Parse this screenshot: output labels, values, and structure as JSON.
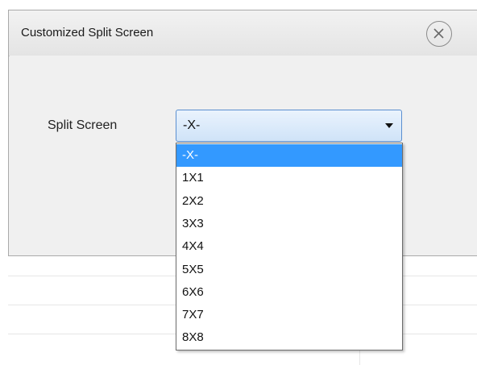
{
  "dialog": {
    "title": "Customized Split Screen",
    "close_icon": "close-circle-icon"
  },
  "form": {
    "split_screen_label": "Split Screen",
    "split_screen_value": "-X-"
  },
  "dropdown": {
    "selected_index": 0,
    "options": [
      "-X-",
      "1X1",
      "2X2",
      "3X3",
      "4X4",
      "5X5",
      "6X6",
      "7X7",
      "8X8"
    ]
  },
  "colors": {
    "highlight": "#3399ff",
    "select_border": "#5b8fd0"
  }
}
